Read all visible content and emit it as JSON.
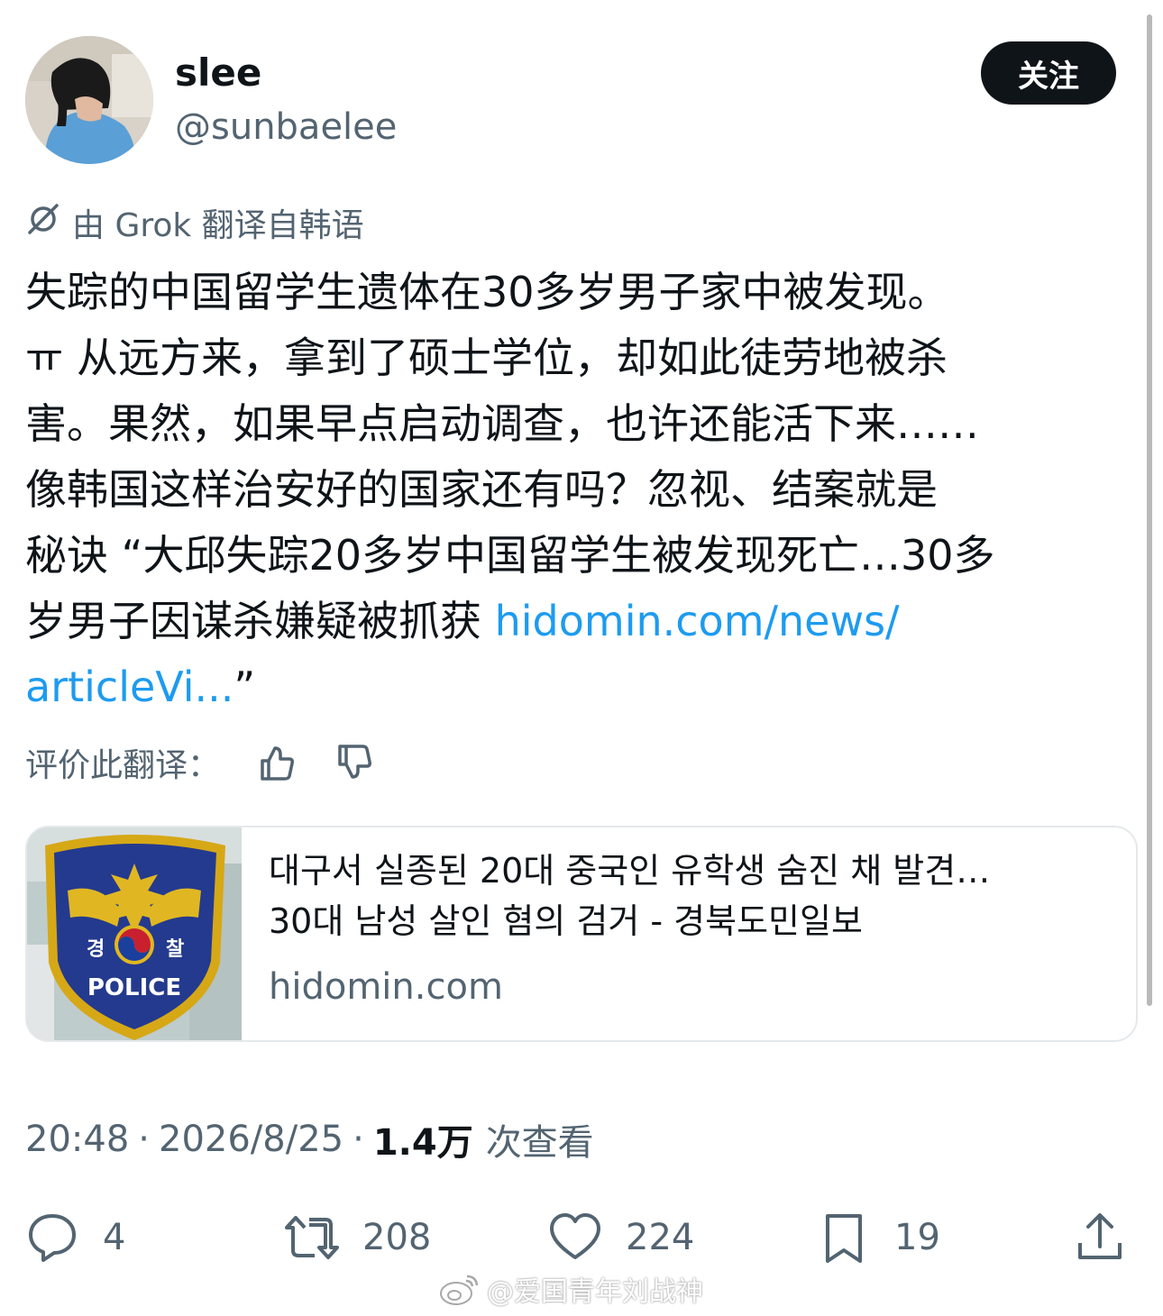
{
  "user": {
    "name": "slee",
    "handle": "@sunbaelee",
    "follow_label": "关注"
  },
  "translation": {
    "note": "由 Grok 翻译自韩语",
    "icon": "grok-icon"
  },
  "tweet": {
    "text_lines": [
      "失踪的中国留学生遗体在30多岁男子家中被发现。",
      "ㅠ 从远方来，拿到了硕士学位，却如此徒劳地被杀",
      "害。果然，如果早点启动调查，也许还能活下来……",
      "像韩国这样治安好的国家还有吗？忽视、结案就是",
      "秘诀 “大邱失踪20多岁中国留学生被发现死亡…30多",
      "岁男子因谋杀嫌疑被抓获 "
    ],
    "link_part1": "hidomin.com/news/",
    "link_part2": "articleVi...",
    "closing_quote": "”"
  },
  "rate_translation": {
    "label": "评价此翻译：",
    "up_icon": "thumbs-up-icon",
    "down_icon": "thumbs-down-icon"
  },
  "card": {
    "title_line1": "대구서 실종된 20대 중국인 유학생 숨진 채 발견…",
    "title_line2": "30대 남성 살인 혐의 검거 - 경북도민일보",
    "domain": "hidomin.com",
    "thumb_text_left": "경",
    "thumb_text_right": "찰",
    "thumb_text_police": "POLICE"
  },
  "meta": {
    "time": "20:48",
    "date": "2026/8/25",
    "separator": "·",
    "views_count": "1.4万",
    "views_label": "次查看"
  },
  "actions": {
    "reply_count": "4",
    "retweet_count": "208",
    "like_count": "224",
    "bookmark_count": "19"
  },
  "watermark": {
    "text": "@爱国青年刘战神"
  },
  "colors": {
    "text": "#0f1419",
    "secondary": "#536471",
    "link": "#1d9bf0",
    "button_bg": "#0f1419"
  }
}
